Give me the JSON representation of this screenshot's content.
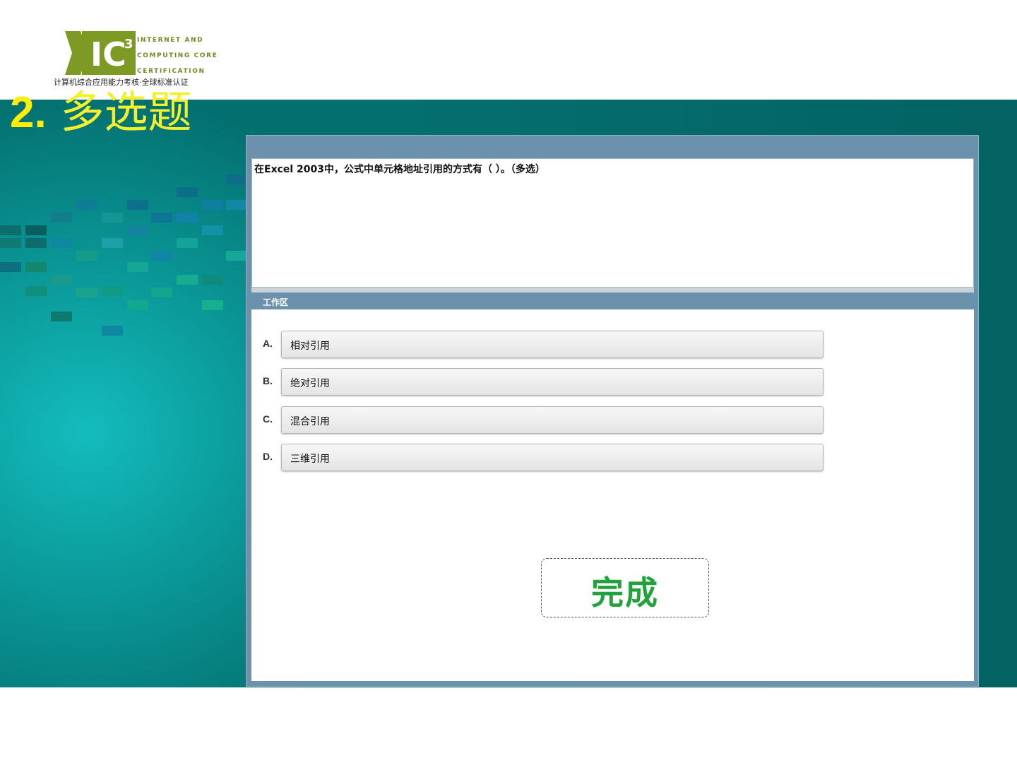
{
  "logo": {
    "mark": "IC3",
    "line1": "INTERNET AND",
    "line2": "COMPUTING CORE",
    "line3": "CERTIFICATION",
    "subtitle": "计算机综合应用能力考核·全球标准认证"
  },
  "slide": {
    "title_num": "2.",
    "title_text": "多选题"
  },
  "question": {
    "text": "在Excel 2003中，公式中单元格地址引用的方式有（    ）。（多选）"
  },
  "workspace": {
    "label": "工作区",
    "options": [
      {
        "letter": "A.",
        "text": "相对引用"
      },
      {
        "letter": "B.",
        "text": "绝对引用"
      },
      {
        "letter": "C.",
        "text": "混合引用"
      },
      {
        "letter": "D.",
        "text": "三维引用"
      }
    ],
    "done_label": "完成"
  },
  "colors": {
    "teal_band": "#056b6b",
    "window_frame": "#6b91ad",
    "title_yellow": "#f3f02c",
    "done_green": "#22a23a",
    "logo_green": "#6f8a1f"
  }
}
